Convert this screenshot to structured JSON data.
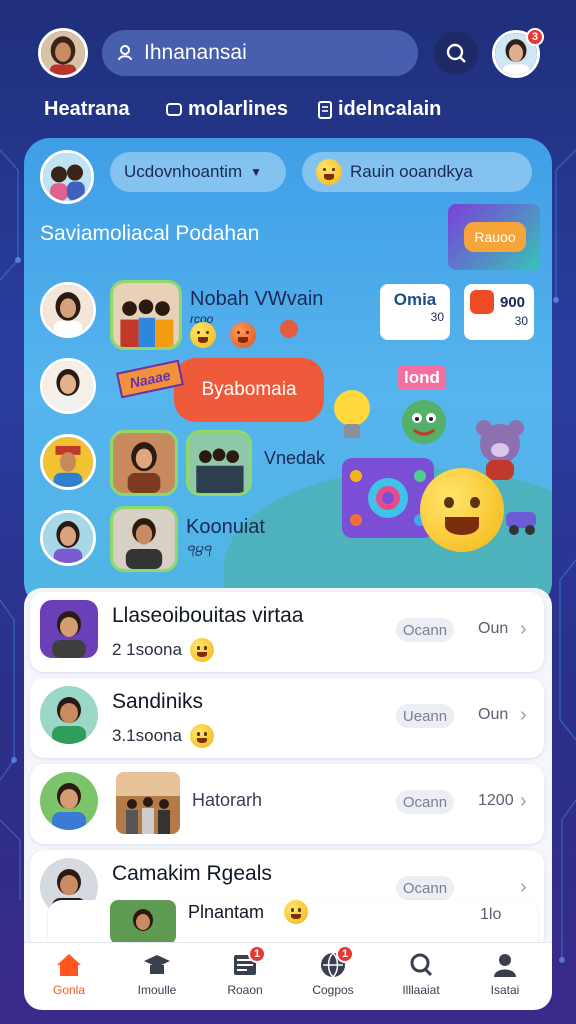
{
  "header": {
    "search_text": "Ihnanansai",
    "notification_count": "3"
  },
  "nav": {
    "items": [
      {
        "label": "Heatrana"
      },
      {
        "label": "molarlines"
      },
      {
        "label": "idelncalain"
      }
    ]
  },
  "hero": {
    "pill_left": "Ucdovnhoantim",
    "pill_right": "Rauin ooandkya",
    "title": "Saviamoliacal Podahan",
    "promo_label": "Rauoo",
    "item1_title": "Nobah VWvain",
    "item1_sub": "rcoo",
    "tag1_title": "Omia",
    "tag1_num": "30",
    "tag2_title": "900",
    "tag2_num": "30",
    "speech_text": "Byabomaia",
    "sticker_text": "Naaae",
    "item2_title": "Vnedak",
    "item3_title": "Koonuiat",
    "item3_sub": "੧੪੧",
    "badge_word": "lond"
  },
  "list": {
    "rows": [
      {
        "title": "Llaseoibouitas virtaa",
        "sub": "2 1soona",
        "chip": "Ocann",
        "value": "Oun"
      },
      {
        "title": "Sandiniks",
        "sub": "3.1soona",
        "chip": "Ueann",
        "value": "Oun"
      },
      {
        "title": "Hatorarh",
        "sub": "",
        "chip": "Ocann",
        "value": "1200"
      },
      {
        "title": "Camakim Rgeals",
        "sub": "",
        "chip": "Ocann",
        "value": ""
      },
      {
        "title": "Plnantam",
        "sub": "",
        "chip": "",
        "value": "1lo"
      }
    ]
  },
  "bottom_nav": {
    "items": [
      {
        "label": "Gonla",
        "icon": "home-icon",
        "badge": ""
      },
      {
        "label": "Imoulle",
        "icon": "graduation-cap-icon",
        "badge": ""
      },
      {
        "label": "Roaon",
        "icon": "news-icon",
        "badge": "1"
      },
      {
        "label": "Cogpos",
        "icon": "globe-icon",
        "badge": "1"
      },
      {
        "label": "Illlaaiat",
        "icon": "search-icon",
        "badge": ""
      },
      {
        "label": "Isatai",
        "icon": "person-icon",
        "badge": ""
      }
    ]
  },
  "colors": {
    "accent": "#ff5722",
    "hero_blue": "#4aa7ea",
    "badge_red": "#e53935"
  }
}
